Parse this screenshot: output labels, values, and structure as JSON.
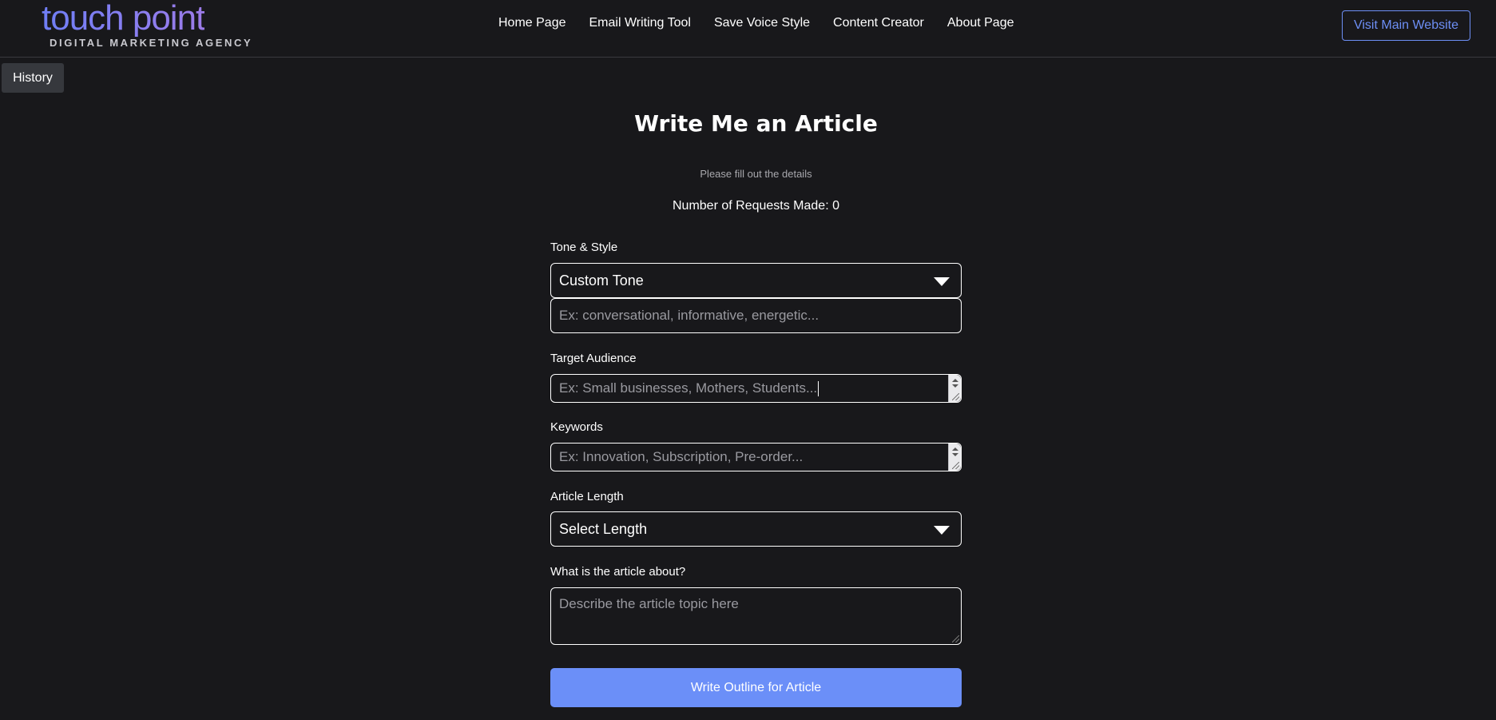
{
  "header": {
    "logo": {
      "main": "touch point",
      "sub": "DIGITAL MARKETING AGENCY"
    },
    "nav": [
      {
        "label": "Home Page"
      },
      {
        "label": "Email Writing Tool"
      },
      {
        "label": "Save Voice Style"
      },
      {
        "label": "Content Creator"
      },
      {
        "label": "About Page"
      }
    ],
    "visit_button": "Visit Main Website"
  },
  "history_button": "History",
  "main": {
    "title": "Write Me an Article",
    "subtitle": "Please fill out the details",
    "requests": "Number of Requests Made: 0"
  },
  "form": {
    "tone": {
      "label": "Tone & Style",
      "selected": "Custom Tone",
      "custom_placeholder": "Ex: conversational, informative, energetic..."
    },
    "audience": {
      "label": "Target Audience",
      "placeholder": "Ex: Small businesses, Mothers, Students..."
    },
    "keywords": {
      "label": "Keywords",
      "placeholder": "Ex: Innovation, Subscription, Pre-order..."
    },
    "length": {
      "label": "Article Length",
      "selected": "Select Length"
    },
    "topic": {
      "label": "What is the article about?",
      "placeholder": "Describe the article topic here"
    },
    "submit_label": "Write Outline for Article"
  },
  "colors": {
    "background": "#18181b",
    "accent": "#6b8ff8",
    "logo_gradient_start": "#6f7ef5",
    "logo_gradient_end": "#9c7be8"
  }
}
